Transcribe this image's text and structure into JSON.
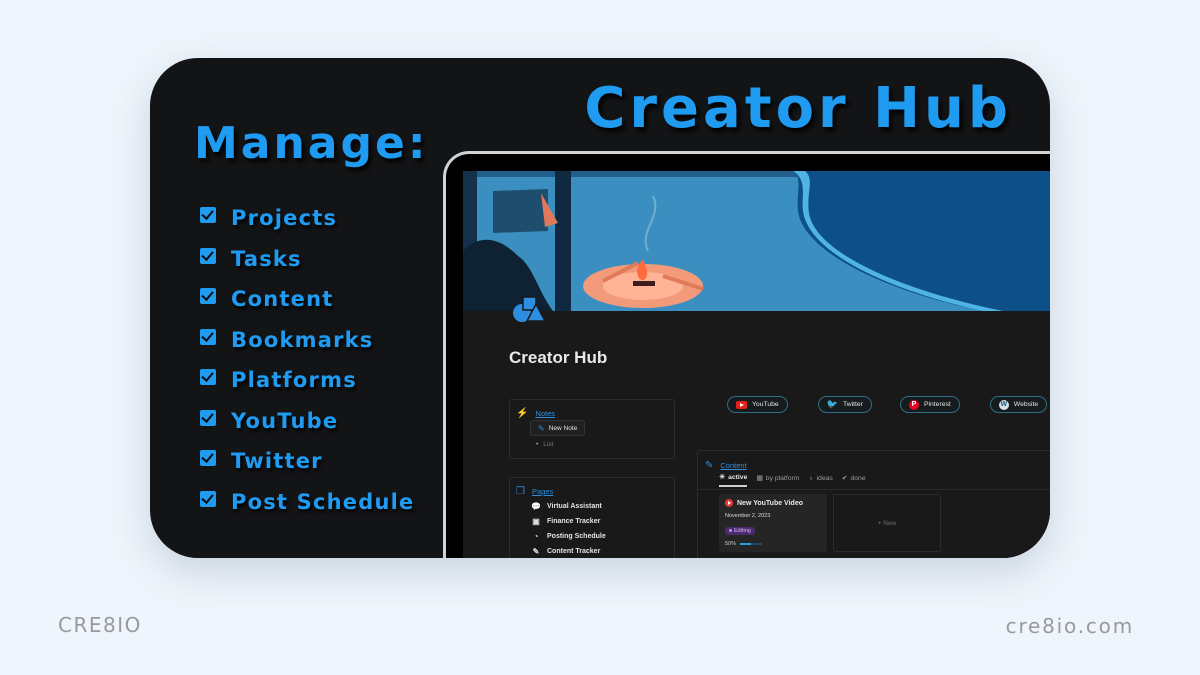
{
  "headline": "Creator Hub",
  "manage_title": "Manage:",
  "checklist": [
    {
      "label": "Projects",
      "checked": true
    },
    {
      "label": "Tasks",
      "checked": true
    },
    {
      "label": "Content",
      "checked": true
    },
    {
      "label": "Bookmarks",
      "checked": true
    },
    {
      "label": "Platforms",
      "checked": true
    },
    {
      "label": "YouTube",
      "checked": true
    },
    {
      "label": "Twitter",
      "checked": true
    },
    {
      "label": "Post Schedule",
      "checked": true
    }
  ],
  "colors": {
    "accent": "#1f9bf2",
    "card_bg": "#131416",
    "page_bg": "#eef5fc",
    "notion_bg": "#191919",
    "link": "#2d8ee0"
  },
  "notion": {
    "page_icon": "shapes-icon",
    "page_title": "Creator Hub",
    "notes": {
      "heading": "Notes",
      "icon": "bolt-icon",
      "new_button": "New Note",
      "list_item": "List"
    },
    "pages": {
      "heading": "Pages",
      "icon": "copy-icon",
      "items": [
        {
          "label": "Virtual Assistant",
          "icon": "chat-icon"
        },
        {
          "label": "Finance Tracker",
          "icon": "money-icon"
        },
        {
          "label": "Posting Schedule",
          "icon": "clock-icon"
        },
        {
          "label": "Content Tracker",
          "icon": "edit-icon"
        }
      ]
    },
    "platforms": [
      {
        "label": "YouTube",
        "icon": "youtube-icon"
      },
      {
        "label": "Twitter",
        "icon": "twitter-icon"
      },
      {
        "label": "Pinterest",
        "icon": "pinterest-icon"
      },
      {
        "label": "Website",
        "icon": "wordpress-icon"
      }
    ],
    "content": {
      "heading": "Content",
      "tabs": [
        {
          "label": "active",
          "icon": "lightbulb-on-icon",
          "active": true
        },
        {
          "label": "by platform",
          "icon": "grid-icon",
          "active": false
        },
        {
          "label": "ideas",
          "icon": "lightbulb-icon",
          "active": false
        },
        {
          "label": "done",
          "icon": "check-circle-icon",
          "active": false
        }
      ],
      "cards": [
        {
          "title": "New YouTube Video",
          "date": "November 2, 2023",
          "status": "Editing",
          "progress_label": "50%",
          "progress": 0.5
        }
      ],
      "new_label": "+ New"
    }
  },
  "footer": {
    "brand_left": "CRE8IO",
    "brand_right": "cre8io.com"
  }
}
